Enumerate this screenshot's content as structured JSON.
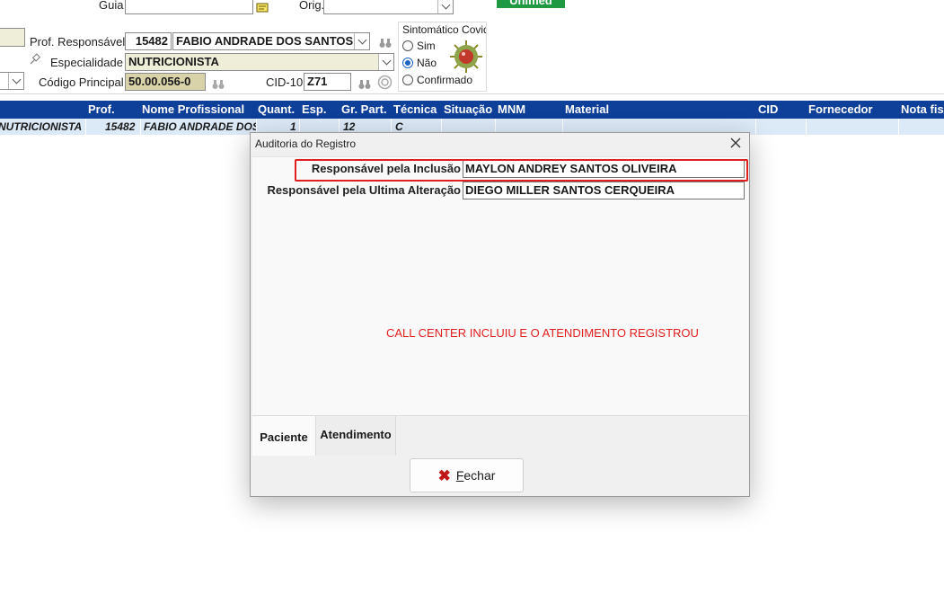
{
  "form": {
    "guia_label": "Guia",
    "orig_label": "Orig.",
    "prof_label": "Prof. Responsável",
    "prof_code": "15482",
    "prof_name": "FABIO ANDRADE DOS SANTOS",
    "esp_label": "Especialidade",
    "esp_value": "NUTRICIONISTA",
    "codigo_label": "Código Principal",
    "codigo_value": "50.00.056-0",
    "cid_label": "CID-10",
    "cid_value": "Z71",
    "covid_title": "Sintomático Covid",
    "covid_options": [
      "Sim",
      "Não",
      "Confirmado"
    ],
    "covid_selected": "Não",
    "brand": "Unimed"
  },
  "grid": {
    "columns": [
      "Prof.",
      "Nome Profissional",
      "Quant.",
      "Esp.",
      "Gr. Part.",
      "Técnica",
      "Situação",
      "MNM",
      "Material",
      "CID",
      "Fornecedor",
      "Nota fis"
    ],
    "row": {
      "especialidade": "NUTRICIONISTA",
      "prof": "15482",
      "nome": "FABIO ANDRADE DOS",
      "quant": "1",
      "gr_part": "12",
      "tecnica": "C"
    }
  },
  "dialog": {
    "title": "Auditoria do Registro",
    "inclusao_label": "Responsável pela Inclusão",
    "inclusao_value": "MAYLON ANDREY SANTOS OLIVEIRA",
    "alteracao_label": "Responsável pela Ultima Alteração",
    "alteracao_value": "DIEGO MILLER SANTOS CERQUEIRA",
    "note": "CALL CENTER INCLUIU E O ATENDIMENTO REGISTROU",
    "tabs": [
      "Paciente",
      "Atendimento"
    ],
    "active_tab": "Paciente",
    "close_button": "Fechar",
    "highlight_color": "#e01f1f"
  }
}
